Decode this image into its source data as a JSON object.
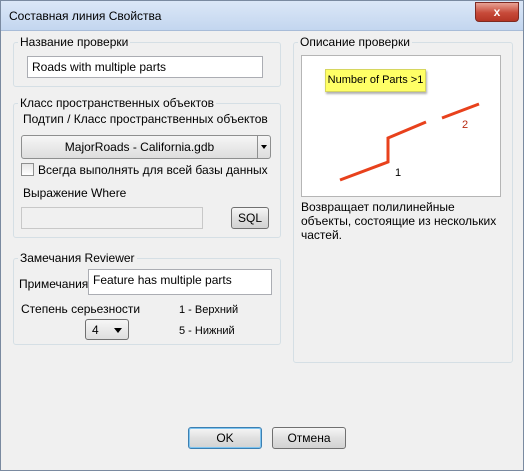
{
  "window": {
    "title": "Составная линия Свойства",
    "close_glyph": "x"
  },
  "check_name": {
    "legend": "Название проверки",
    "value": "Roads with multiple parts"
  },
  "feature_class": {
    "legend": "Класс пространственных объектов",
    "subtype_label": "Подтип / Класс пространственных объектов",
    "combo_value": "MajorRoads -  California.gdb",
    "always_run_label": "Всегда выполнять для всей базы данных",
    "always_run_checked": false,
    "where_label": "Выражение Where",
    "where_value": "",
    "sql_button": "SQL"
  },
  "reviewer": {
    "legend": "Замечания Reviewer",
    "notes_label": "Примечания",
    "notes_value": "Feature has multiple parts",
    "severity_label": "Степень серьезности",
    "severity_value": "4",
    "severity_high": "1 - Верхний",
    "severity_low": "5 - Нижний"
  },
  "description": {
    "legend": "Описание проверки",
    "callout": "Number of Parts >1",
    "part1_label": "1",
    "part2_label": "2",
    "line_color": "#e8411c",
    "text": "Возвращает полилинейные объекты, состоящие из нескольких частей."
  },
  "buttons": {
    "ok": "OK",
    "cancel": "Отмена"
  }
}
